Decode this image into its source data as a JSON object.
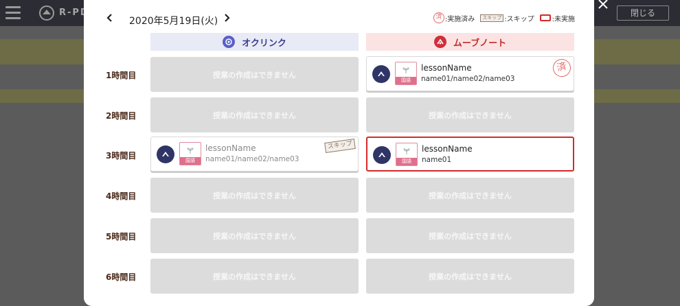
{
  "app": {
    "title": "R-PD",
    "close_label": "閉じる"
  },
  "header": {
    "date": "2020年5月19日(火)"
  },
  "legend": {
    "done_label": ":実施済み",
    "done_icon": "済",
    "skip_label": ":スキップ",
    "skip_icon": "スキップ",
    "undone_label": ":未実施"
  },
  "columns": {
    "left": "オクリンク",
    "right": "ムーブノート"
  },
  "periods": [
    "1時間目",
    "2時間目",
    "3時間目",
    "4時間目",
    "5時間目",
    "6時間目"
  ],
  "empty_text": "授業の作成はできません",
  "cards": {
    "r1_right": {
      "name": "lessonName",
      "members": "name01/name02/name03",
      "subject": "国語",
      "status_stamp": "済"
    },
    "r3_left": {
      "name": "lessonName",
      "members": "name01/name02/name03",
      "subject": "国語",
      "status_stamp": "スキップ"
    },
    "r3_right": {
      "name": "lessonName",
      "members": "name01",
      "subject": "国語"
    }
  },
  "colors": {
    "oklink": "#5b5fc7",
    "movenote": "#d12d3a",
    "undone_border": "#d22a2a"
  }
}
